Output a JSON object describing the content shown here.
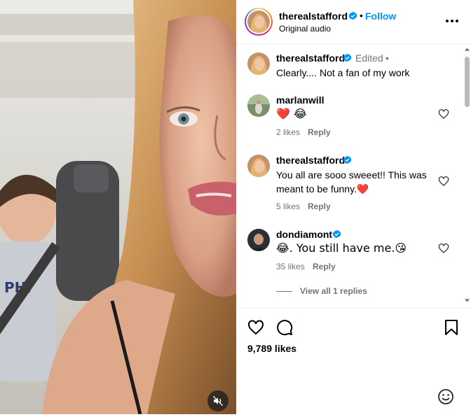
{
  "post": {
    "username": "therealstafford",
    "follow_label": "Follow",
    "separator": "•",
    "audio": "Original audio",
    "more_icon": "more-horizontal-icon"
  },
  "comments": [
    {
      "username": "therealstafford",
      "verified": true,
      "edited_label": "Edited",
      "edited_sep": "•",
      "text": "Clearly.... Not a fan of my work"
    },
    {
      "username": "marlanwill",
      "verified": false,
      "text": "❤️ 😂",
      "likes": "2 likes",
      "reply_label": "Reply"
    },
    {
      "username": "therealstafford",
      "verified": true,
      "text": "You all are sooo sweeet!! This was meant to be funny.❤️",
      "likes": "5 likes",
      "reply_label": "Reply"
    },
    {
      "username": "dondiamont",
      "verified": true,
      "text": "😂. You still have me.😘",
      "likes": "35 likes",
      "reply_label": "Reply",
      "view_replies": "View all 1 replies"
    }
  ],
  "actions": {
    "likes_count": "9,789 likes",
    "like_icon": "heart-icon",
    "comment_icon": "comment-bubble-icon",
    "save_icon": "bookmark-icon",
    "emoji_icon": "smiley-icon"
  },
  "colors": {
    "accent": "#0095f6",
    "secondary_text": "#737373",
    "heart_red": "#e0245e",
    "divider": "#efefef"
  }
}
